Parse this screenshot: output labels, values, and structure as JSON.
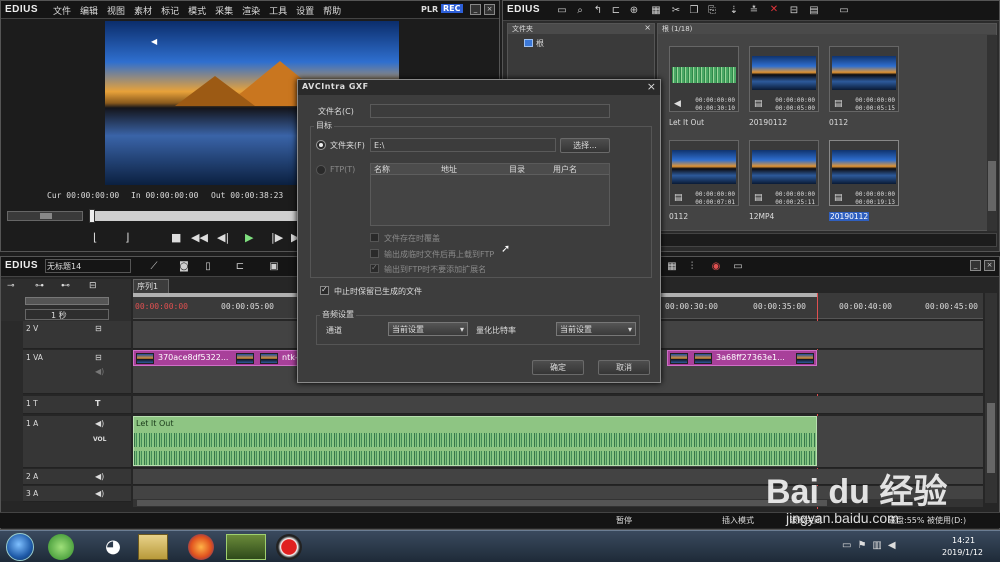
{
  "app": {
    "name": "EDIUS",
    "menu": [
      "文件",
      "编辑",
      "视图",
      "素材",
      "标记",
      "模式",
      "采集",
      "渲染",
      "工具",
      "设置",
      "帮助"
    ],
    "plr": "PLR",
    "rec": "REC"
  },
  "player": {
    "cur": "Cur 00:00:00:00",
    "in": "In 00:00:00:00",
    "out": "Out 00:00:38:23"
  },
  "bin": {
    "logo": "EDIUS",
    "folder_header": "文件夹",
    "root_label": "根",
    "path": "根 (1/18)",
    "clips": [
      {
        "name": "Let It Out",
        "tc1": "00:00:00:00",
        "tc2": "00:00:30:10",
        "type": "audio"
      },
      {
        "name": "20190112",
        "tc1": "00:00:00:00",
        "tc2": "00:00:05:00",
        "type": "video"
      },
      {
        "name": "0112",
        "tc1": "00:00:00:00",
        "tc2": "00:00:05:15",
        "type": "video"
      },
      {
        "name": "0112",
        "tc1": "00:00:00:00",
        "tc2": "00:00:07:01",
        "type": "video"
      },
      {
        "name": "12MP4",
        "tc1": "00:00:00:00",
        "tc2": "00:00:25:11",
        "type": "video"
      },
      {
        "name": "20190112",
        "tc1": "00:00:00:00",
        "tc2": "00:00:19:13",
        "type": "video",
        "selected": true
      }
    ]
  },
  "timeline": {
    "logo": "EDIUS",
    "project": "无标题14",
    "sequence_tab": "序列1",
    "scale": "1 秒",
    "ruler": [
      "00:00:00:00",
      "00:00:05:00",
      "00:00:30:00",
      "00:00:35:00",
      "00:00:40:00",
      "00:00:45:00"
    ],
    "tracks": [
      {
        "name": "2 V"
      },
      {
        "name": "1 VA"
      },
      {
        "name": "1 T"
      },
      {
        "name": "1 A"
      },
      {
        "name": "2 A"
      },
      {
        "name": "3 A"
      }
    ],
    "vol_label": "VOL",
    "clip_left": "370ace8df5322...",
    "clip_mid": "ntk-",
    "clip_right": "3a68ff27363e1...",
    "audio_clip": "Let It Out"
  },
  "dialog": {
    "title": "AVCIntra GXF",
    "filename_label": "文件名(C)",
    "filename_value": "",
    "target_group": "目标",
    "folder_label": "文件夹(F)",
    "folder_value": "E:\\",
    "browse_button": "选择...",
    "ftp_label": "FTP(T)",
    "ftp_columns": [
      "名称",
      "地址",
      "目录",
      "用户名"
    ],
    "opt_overwrite": "文件存在时覆盖",
    "opt_upload": "输出成临时文件后再上载到FTP",
    "opt_ext": "输出到FTP时不要添加扩展名",
    "keep_files": "中止时保留已生成的文件",
    "audio_group": "音频设置",
    "channel_label": "通道",
    "channel_value": "当前设置",
    "bitdepth_label": "量化比特率",
    "bitdepth_value": "当前设置",
    "ok": "确定",
    "cancel": "取消"
  },
  "status": {
    "pause": "暂停",
    "insert_mode": "插入模式",
    "ripple_off": "波纹关闭",
    "disk": "磁盘:55% 被使用(D:)"
  },
  "taskbar": {
    "time": "14:21",
    "date": "2019/1/12"
  },
  "watermark": {
    "brand": "Bai du 经验",
    "url": "jingyan.baidu.com"
  },
  "colors": {
    "video_clip": "#a8409a",
    "audio_clip": "#8ec583",
    "rec": "#2d5fd8"
  }
}
